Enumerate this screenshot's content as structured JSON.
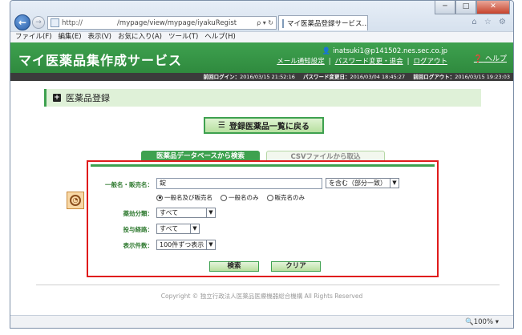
{
  "browser": {
    "address_proto": "http://",
    "address_path": "/mypage/view/mypage/iyakuRegist",
    "address_tools": "ρ ▾ ↻",
    "tab_title": "マイ医薬品登録サービス...",
    "tab_close": "×",
    "window_minimize": "─",
    "window_maximize": "□",
    "window_close": "✕",
    "icons": "⌂ ☆ ⚙",
    "zoom": "🔍100%  ▾"
  },
  "menu": {
    "items": [
      "ファイル(F)",
      "編集(E)",
      "表示(V)",
      "お気に入り(A)",
      "ツール(T)",
      "ヘルプ(H)"
    ]
  },
  "header": {
    "title": "マイ医薬品集作成サービス",
    "user_email": "inatsuki1@p141502.nes.sec.co.jp",
    "links": [
      "メール通知設定",
      "パスワード変更・退会",
      "ログアウト"
    ],
    "link_separator": "|",
    "help": "ヘルプ"
  },
  "login_bar": {
    "prev_login_label": "前回ログイン：",
    "prev_login_value": "2016/03/15 21:52:16",
    "password_changed_label": "パスワード変更日：",
    "password_changed_value": "2016/03/04 18:45:27",
    "prev_logout_label": "前回ログアウト：",
    "prev_logout_value": "2016/03/15 19:23:03"
  },
  "page": {
    "heading": "医薬品登録",
    "back_button": "登録医薬品一覧に戻る"
  },
  "search": {
    "tab_active": "医薬品データベースから検索",
    "tab_inactive": "CSVファイルから取込",
    "name_label": "一般名・販売名：",
    "name_value": "錠",
    "match_select": "を含む（部分一致）",
    "radio_options": [
      "一般名及び販売名",
      "一般名のみ",
      "販売名のみ"
    ],
    "efficacy_label": "薬効分類：",
    "efficacy_value": "すべて",
    "route_label": "投与経路：",
    "route_value": "すべて",
    "count_label": "表示件数：",
    "count_value": "100件ずつ表示",
    "search_button": "検索",
    "clear_button": "クリア"
  },
  "footer": {
    "copyright": "Copyright © 独立行政法人医薬品医療機器総合機構 All Rights Reserved"
  }
}
